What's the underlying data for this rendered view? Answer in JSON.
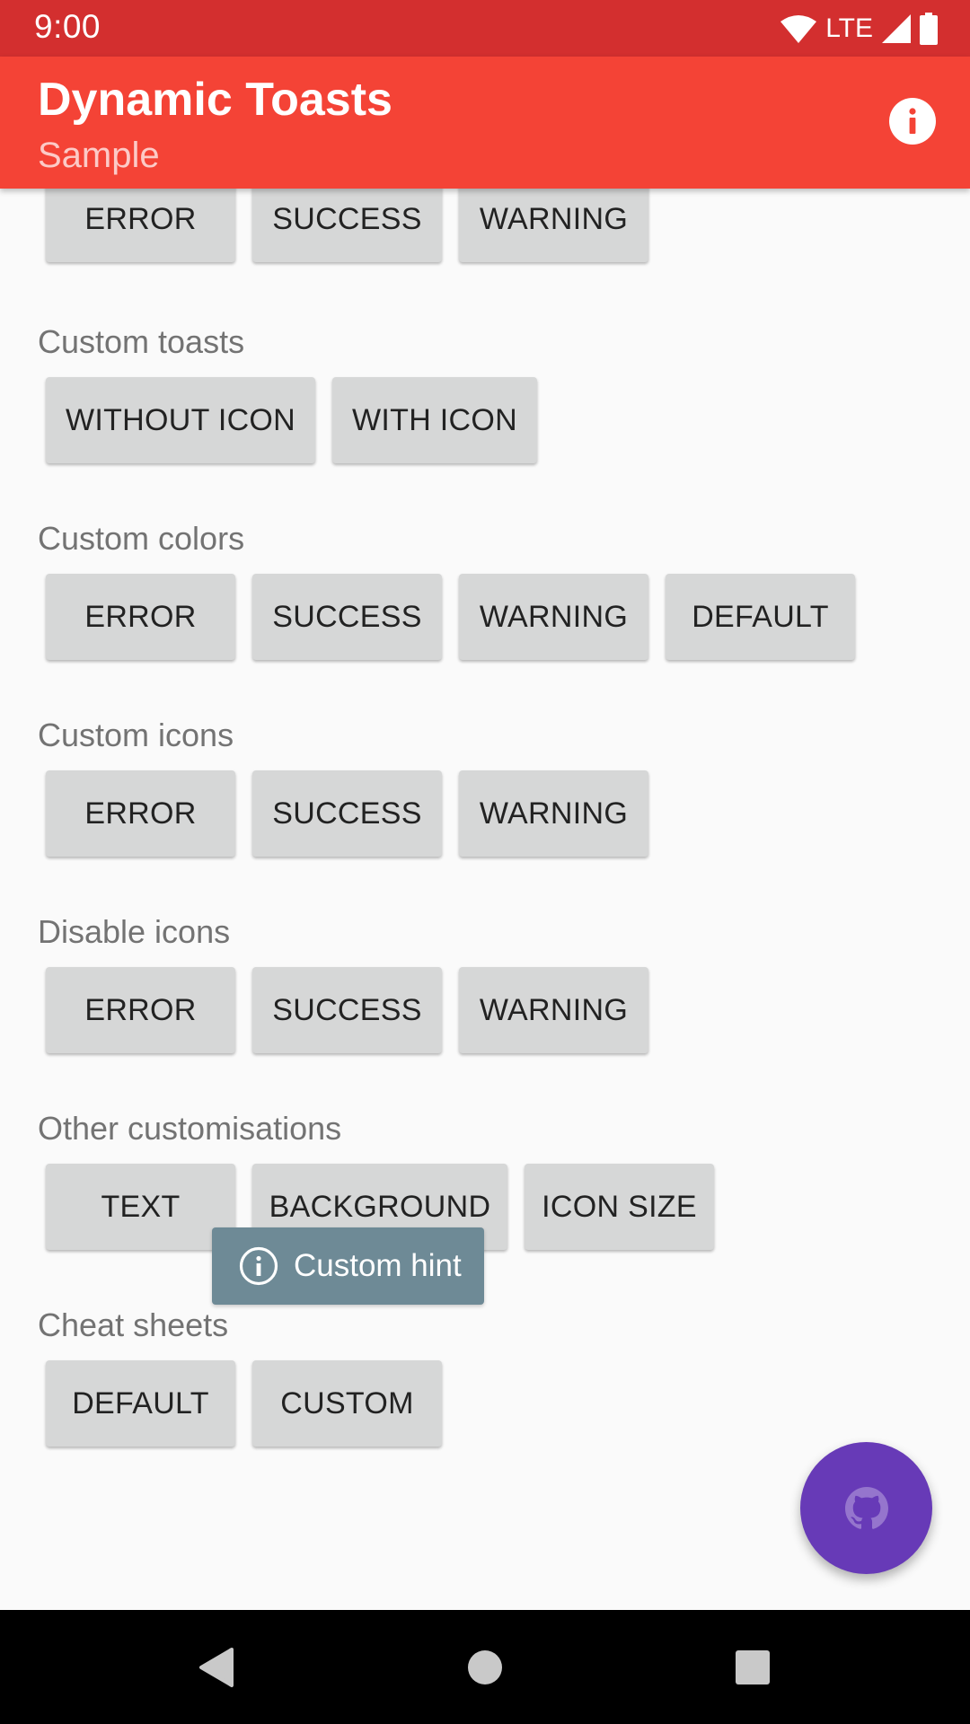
{
  "status_bar": {
    "time": "9:00",
    "network": "LTE"
  },
  "app_bar": {
    "title": "Dynamic Toasts",
    "subtitle": "Sample",
    "info_icon": "info-icon"
  },
  "sections": {
    "top": {
      "buttons": [
        "ERROR",
        "SUCCESS",
        "WARNING"
      ]
    },
    "custom_toasts": {
      "title": "Custom toasts",
      "buttons": [
        "WITHOUT ICON",
        "WITH ICON"
      ]
    },
    "custom_colors": {
      "title": "Custom colors",
      "buttons": [
        "ERROR",
        "SUCCESS",
        "WARNING",
        "DEFAULT"
      ]
    },
    "custom_icons": {
      "title": "Custom icons",
      "buttons": [
        "ERROR",
        "SUCCESS",
        "WARNING"
      ]
    },
    "disable_icons": {
      "title": "Disable icons",
      "buttons": [
        "ERROR",
        "SUCCESS",
        "WARNING"
      ]
    },
    "other": {
      "title": "Other customisations",
      "buttons": [
        "TEXT",
        "BACKGROUND",
        "ICON SIZE"
      ]
    },
    "cheat_sheets": {
      "title": "Cheat sheets",
      "buttons": [
        "DEFAULT",
        "CUSTOM"
      ]
    }
  },
  "toast": {
    "text": "Custom hint",
    "icon": "info-outline-icon"
  },
  "fab": {
    "icon": "github-icon"
  },
  "colors": {
    "status_bar": "#D32F2F",
    "app_bar": "#F44336",
    "fab": "#673AB7",
    "toast": "#6E8A96",
    "button": "#D6D7D7"
  }
}
